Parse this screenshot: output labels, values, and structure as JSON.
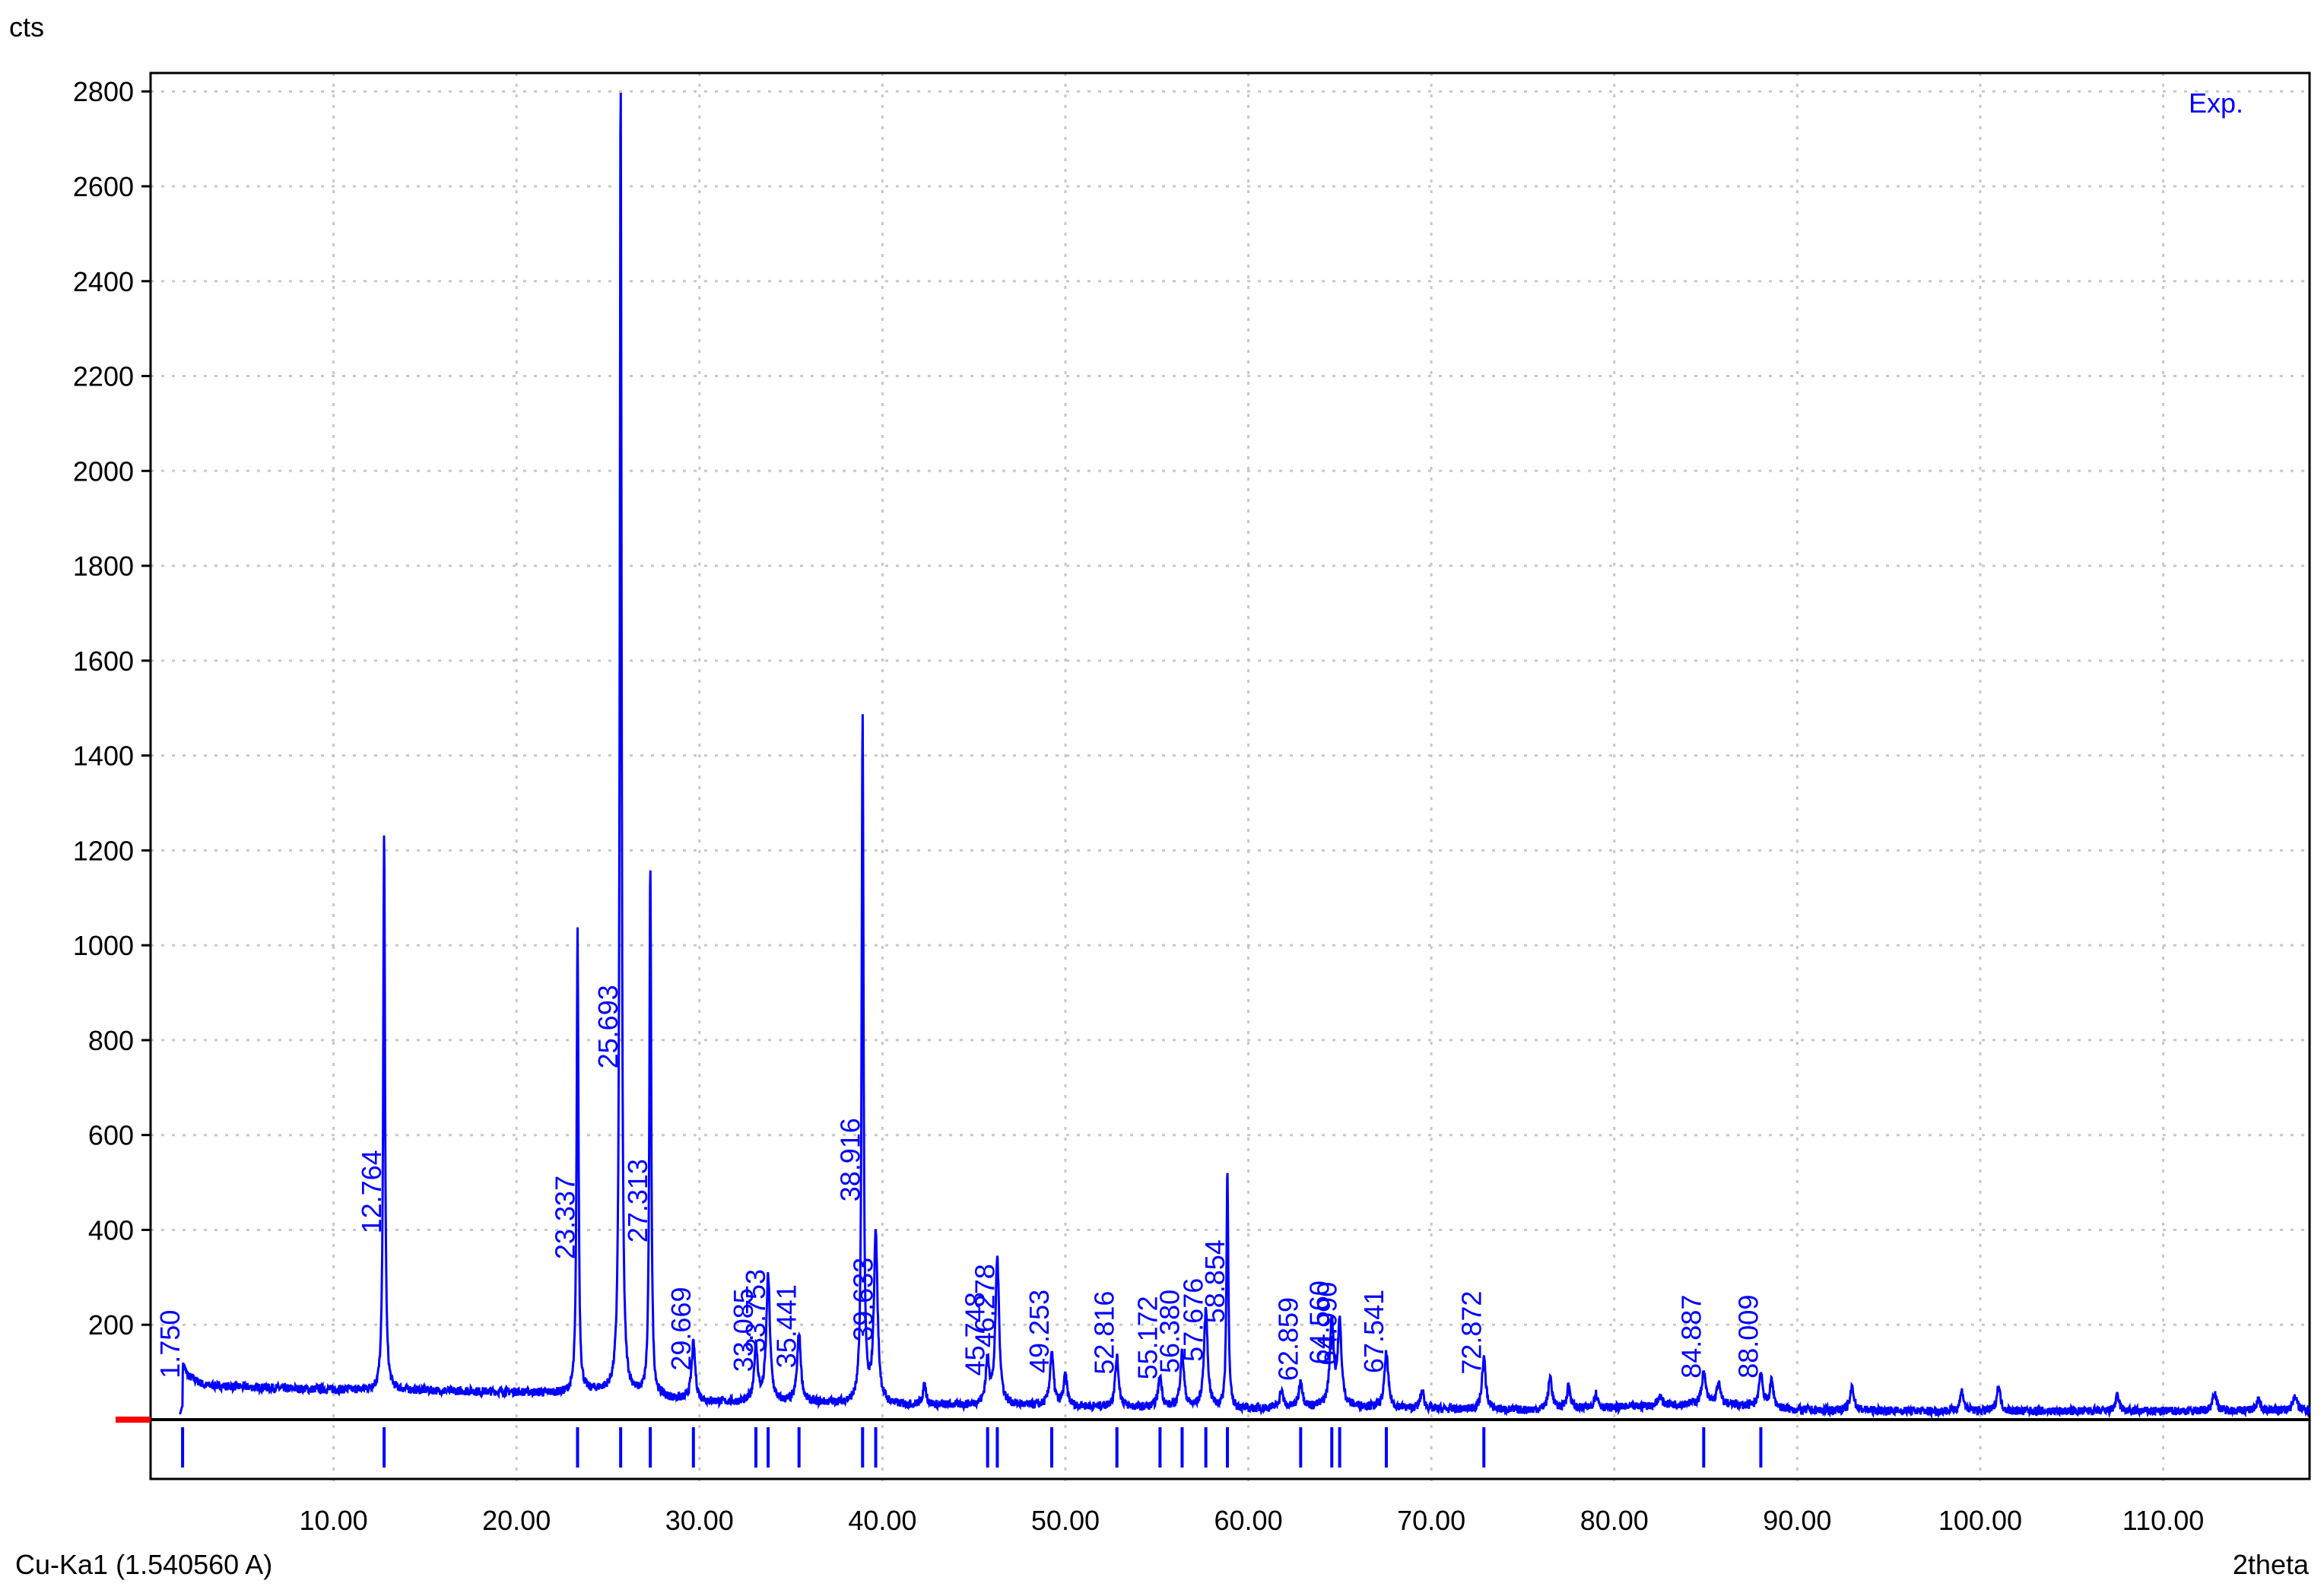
{
  "chart_data": {
    "type": "line",
    "title": "",
    "ylabel": "cts",
    "xlabel": "2theta",
    "wavelength_label": "Cu-Ka1 (1.540560 A)",
    "legend": {
      "entries": [
        "Exp."
      ],
      "placement": "top-right"
    },
    "xlim": [
      0,
      118
    ],
    "ylim": [
      0,
      2850
    ],
    "grid": true,
    "x_ticks": [
      10,
      20,
      30,
      40,
      50,
      60,
      70,
      80,
      90,
      100,
      110
    ],
    "x_tick_labels": [
      "10.00",
      "20.00",
      "30.00",
      "40.00",
      "50.00",
      "60.00",
      "70.00",
      "80.00",
      "90.00",
      "100.00",
      "110.00"
    ],
    "y_ticks": [
      200,
      400,
      600,
      800,
      1000,
      1200,
      1400,
      1600,
      1800,
      2000,
      2200,
      2400,
      2600,
      2800
    ],
    "y_tick_labels": [
      "200",
      "400",
      "600",
      "800",
      "1000",
      "1200",
      "1400",
      "1600",
      "1800",
      "2000",
      "2200",
      "2400",
      "2600",
      "2800"
    ],
    "series_color": "#0000ff",
    "background": [
      [
        1.6,
        0
      ],
      [
        1.8,
        95
      ],
      [
        3,
        72
      ],
      [
        8,
        65
      ],
      [
        12,
        62
      ],
      [
        14,
        62
      ],
      [
        20,
        58
      ],
      [
        23,
        55
      ],
      [
        24.5,
        60
      ],
      [
        28,
        45
      ],
      [
        30,
        38
      ],
      [
        33,
        35
      ],
      [
        37,
        35
      ],
      [
        41,
        30
      ],
      [
        45,
        30
      ],
      [
        50,
        28
      ],
      [
        55,
        25
      ],
      [
        60,
        22
      ],
      [
        65,
        28
      ],
      [
        70,
        22
      ],
      [
        75,
        20
      ],
      [
        80,
        25
      ],
      [
        85,
        35
      ],
      [
        90,
        20
      ],
      [
        100,
        18
      ],
      [
        110,
        18
      ],
      [
        117.9,
        20
      ]
    ],
    "labeled_peaks": [
      {
        "x": 1.75,
        "label": "1.750",
        "intensity": 100
      },
      {
        "x": 12.764,
        "label": "12.764",
        "intensity": 1230
      },
      {
        "x": 23.337,
        "label": "23.337",
        "intensity": 1030
      },
      {
        "x": 25.693,
        "label": "25.693",
        "intensity": 2830
      },
      {
        "x": 27.313,
        "label": "27.313",
        "intensity": 1160
      },
      {
        "x": 29.669,
        "label": "29.669",
        "intensity": 160
      },
      {
        "x": 33.085,
        "label": "33.085",
        "intensity": 150
      },
      {
        "x": 33.753,
        "label": "33.753",
        "intensity": 300
      },
      {
        "x": 35.441,
        "label": "35.441",
        "intensity": 180
      },
      {
        "x": 38.916,
        "label": "38.916",
        "intensity": 1480
      },
      {
        "x": 39.633,
        "label": "39.633",
        "intensity": 390
      },
      {
        "x": 45.748,
        "label": "45.748",
        "intensity": 120
      },
      {
        "x": 46.278,
        "label": "46.278",
        "intensity": 340
      },
      {
        "x": 49.253,
        "label": "49.253",
        "intensity": 140
      },
      {
        "x": 52.816,
        "label": "52.816",
        "intensity": 130
      },
      {
        "x": 55.172,
        "label": "55.172",
        "intensity": 90
      },
      {
        "x": 56.38,
        "label": "56.380",
        "intensity": 140
      },
      {
        "x": 57.676,
        "label": "57.676",
        "intensity": 230
      },
      {
        "x": 58.854,
        "label": "58.854",
        "intensity": 530
      },
      {
        "x": 62.859,
        "label": "62.859",
        "intensity": 80
      },
      {
        "x": 64.56,
        "label": "64.560",
        "intensity": 210
      },
      {
        "x": 64.99,
        "label": "64.990",
        "intensity": 200
      },
      {
        "x": 67.541,
        "label": "67.541",
        "intensity": 140
      },
      {
        "x": 72.872,
        "label": "72.872",
        "intensity": 130
      },
      {
        "x": 84.887,
        "label": "84.887",
        "intensity": 100
      },
      {
        "x": 88.009,
        "label": "88.009",
        "intensity": 100
      }
    ],
    "minor_peaks": [
      {
        "x": 42.3,
        "intensity": 70
      },
      {
        "x": 50.0,
        "intensity": 90
      },
      {
        "x": 61.8,
        "intensity": 60
      },
      {
        "x": 69.5,
        "intensity": 60
      },
      {
        "x": 76.5,
        "intensity": 90
      },
      {
        "x": 77.5,
        "intensity": 70
      },
      {
        "x": 79.0,
        "intensity": 55
      },
      {
        "x": 82.5,
        "intensity": 50
      },
      {
        "x": 85.7,
        "intensity": 75
      },
      {
        "x": 88.6,
        "intensity": 80
      },
      {
        "x": 93.0,
        "intensity": 70
      },
      {
        "x": 99.0,
        "intensity": 60
      },
      {
        "x": 101.0,
        "intensity": 70
      },
      {
        "x": 107.5,
        "intensity": 50
      },
      {
        "x": 112.8,
        "intensity": 60
      },
      {
        "x": 115.2,
        "intensity": 45
      },
      {
        "x": 117.2,
        "intensity": 50
      }
    ]
  }
}
